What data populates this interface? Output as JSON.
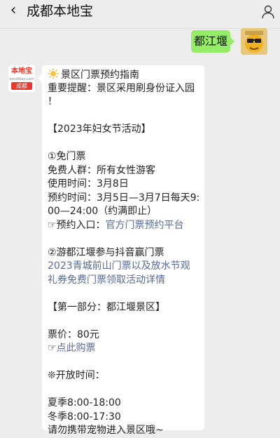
{
  "header": {
    "title": "成都本地宝",
    "back_icon": "chevron-left-icon",
    "profile_icon": "person-icon"
  },
  "user_message": {
    "text": "都江堰"
  },
  "bot_avatar": {
    "brand_text": "本地宝",
    "domain_text": "bendibao.com",
    "city_text": "成都"
  },
  "bot_message": {
    "l01": "景区门票预约指南",
    "l02": "重要提醒：景区采用刷身份证入园",
    "l03": "！",
    "l05": "【2023年妇女节活动】",
    "l07": "①免门票",
    "l08": "免费人群：所有女性游客",
    "l09": "使用时间：3月8日",
    "l10": "预约时间：3月5日—3月7日每天9:",
    "l11": "00—24:00（约满即止）",
    "l12_prefix": "☞预约入口：",
    "l12_link": "官方门票预约平台",
    "l14": "②游都江堰参与抖音赢门票",
    "l15": "2023青城前山门票以及放水节观",
    "l16": "礼券免费门票领取活动详情",
    "l18": "【第一部分：都江堰景区】",
    "l20": "票价：80元",
    "l21_prefix": "☞",
    "l21_link": "点此购票",
    "l23": "❊开放时间：",
    "l25": "夏季8:00-18:00",
    "l26": "冬季8:00-17:30",
    "l27": "请勿携带宠物进入景区哦~"
  },
  "colors": {
    "background": "#ededed",
    "user_bubble": "#95ec69",
    "bot_bubble": "#ffffff",
    "link": "#576b95",
    "brand_red": "#e8382b"
  }
}
